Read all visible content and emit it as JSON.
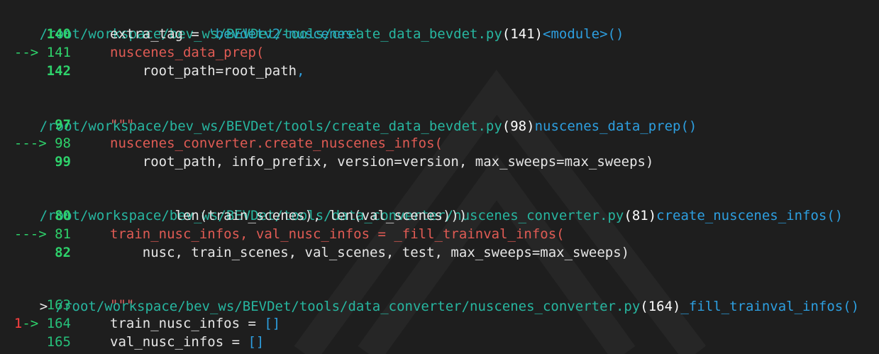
{
  "frames": [
    {
      "header": {
        "prefix": "",
        "path": "/root/workspace/bev_ws/BEVDet/tools/create_data_bevdet.py",
        "line": "(141)",
        "func": "<module>()"
      },
      "lines": [
        {
          "num": "140",
          "code_a": "extra_tag = ",
          "code_b": "'bevdetv2-nuscenes'"
        },
        {
          "marker": "--> ",
          "num": "141",
          "code_a": "nuscenes_data_prep("
        },
        {
          "num": "142",
          "code_a": "    root_path=root_path",
          "code_b": ","
        }
      ]
    },
    {
      "header": {
        "prefix": "",
        "path": "/root/workspace/bev_ws/BEVDet/tools/create_data_bevdet.py",
        "line": "(98)",
        "func": "nuscenes_data_prep()"
      },
      "lines": [
        {
          "num": "97",
          "code_a": "\"\"\""
        },
        {
          "marker": "---> ",
          "num": "98",
          "code_a": "nuscenes_converter.create_nuscenes_infos("
        },
        {
          "num": "99",
          "code_a": "    root_path, info_prefix, version=version, max_sweeps=max_sweeps)"
        }
      ]
    },
    {
      "header": {
        "prefix": "",
        "path": "/root/workspace/bev_ws/BEVDet/tools/data_converter/nuscenes_converter.py",
        "line": "(81)",
        "func": "create_nuscenes_infos()"
      },
      "lines": [
        {
          "num": "80",
          "code_a": "        len(train_scenes), len(val_scenes)))"
        },
        {
          "marker": "---> ",
          "num": "81",
          "code_a": "train_nusc_infos, val_nusc_infos = _fill_trainval_infos("
        },
        {
          "num": "82",
          "code_a": "    nusc, train_scenes, val_scenes, test, max_sweeps=max_sweeps)"
        }
      ]
    },
    {
      "header": {
        "prefix": "> ",
        "path": "/root/workspace/bev_ws/BEVDet/tools/data_converter/nuscenes_converter.py",
        "line": "(164)",
        "func": "_fill_trainval_infos()"
      },
      "lines": [
        {
          "num": "163",
          "code_a": "\"\"\""
        },
        {
          "bp": "1",
          "marker": "-> ",
          "num": "164",
          "code_a": "train_nusc_infos = ",
          "code_b": "[]"
        },
        {
          "num": "165",
          "code_a": "val_nusc_infos = ",
          "code_b": "[]"
        }
      ]
    }
  ],
  "colors": {
    "background": "#1e1e1e",
    "path": "#27b6a0",
    "function": "#2d9fe0",
    "line_number": "#2ed26b",
    "current_code": "#e05b54",
    "breakpoint": "#ff4040"
  }
}
